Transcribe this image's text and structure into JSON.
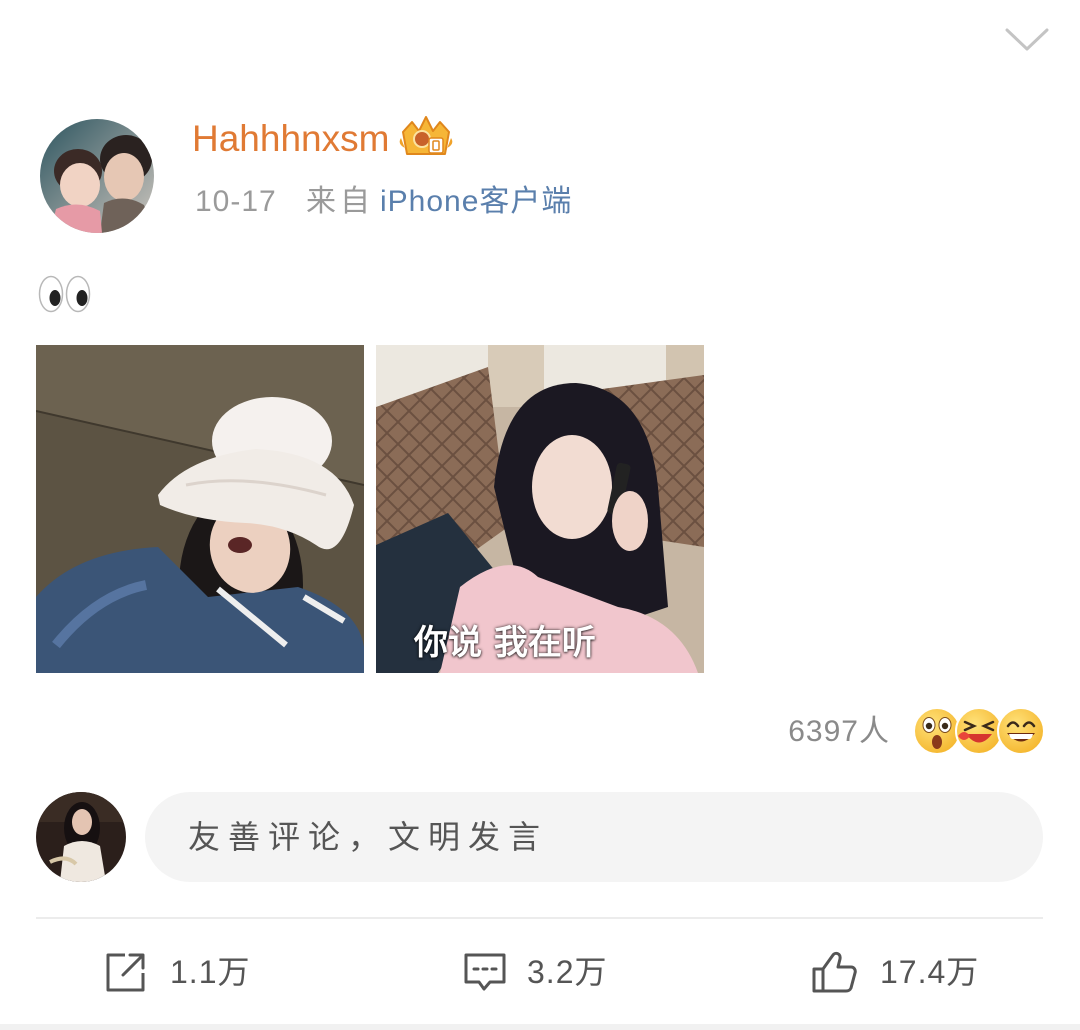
{
  "post": {
    "author": {
      "name": "Hahhhnxsm",
      "avatar_icon": "author-avatar",
      "badge_icon": "crown-badge-icon"
    },
    "date": "10-17",
    "source_prefix": "来自",
    "source": "iPhone客户端",
    "content_icon": "eyes-emoji-icon",
    "images": [
      {
        "caption": ""
      },
      {
        "caption": "你说 我在听"
      }
    ]
  },
  "reactions": {
    "count": "6397人",
    "emoji_icons": [
      "surprised-face-icon",
      "laughing-face-icon",
      "grinning-face-icon"
    ]
  },
  "comment_box": {
    "avatar_icon": "current-user-avatar",
    "placeholder": "友善评论，文明发言"
  },
  "actions": [
    {
      "icon": "share-icon",
      "label": "1.1万"
    },
    {
      "icon": "comment-icon",
      "label": "3.2万"
    },
    {
      "icon": "like-icon",
      "label": "17.4万"
    }
  ],
  "colors": {
    "author_name": "#e07a34",
    "source_link": "#5a7fac",
    "meta_text": "#9a9a9a",
    "placeholder_bg": "#f4f4f4",
    "action_text": "#555555"
  }
}
